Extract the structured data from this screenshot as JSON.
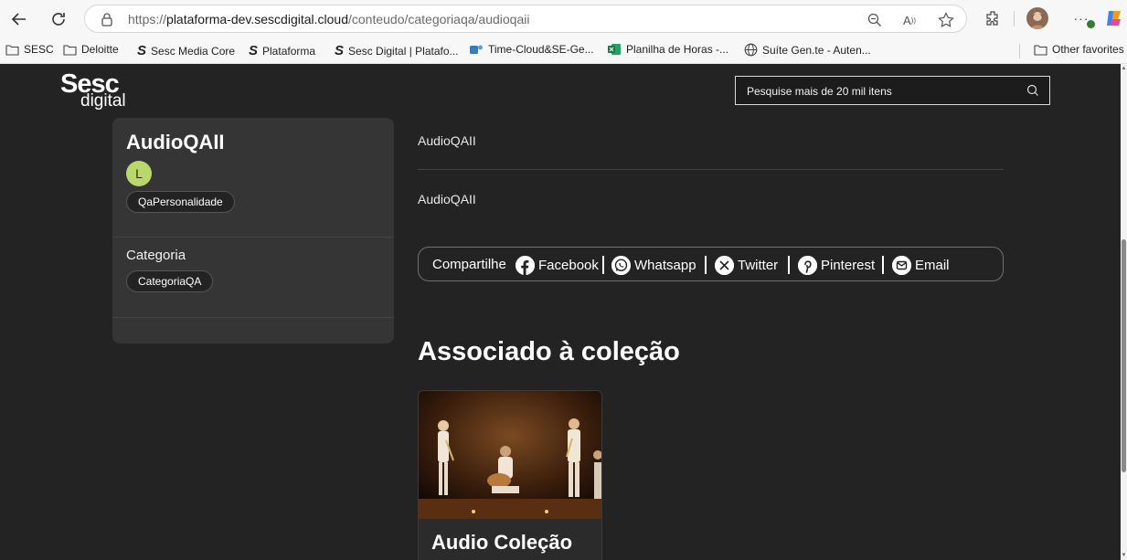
{
  "browser": {
    "url_prefix": "https://",
    "url_host": "plataforma-dev.sescdigital.cloud",
    "url_path": "/conteudo/categoriaqa/audioqaii",
    "bookmarks": [
      "SESC",
      "Deloitte",
      "Sesc Media Core",
      "Plataforma",
      "Sesc Digital | Platafo...",
      "Time-Cloud&SE-Ge...",
      "Planilha de Horas -...",
      "Suíte Gen.te - Auten...",
      "Other favorites"
    ]
  },
  "site": {
    "logo_line1": "Sesc",
    "logo_line2": "digital",
    "search_placeholder": "Pesquise mais de 20 mil itens"
  },
  "card": {
    "title": "AudioQAII",
    "avatar_letter": "L",
    "personality_chip": "QaPersonalidade",
    "category_label": "Categoria",
    "category_chip": "CategoriaQA"
  },
  "main": {
    "info_line1": "AudioQAII",
    "info_line2": "AudioQAII",
    "share": {
      "label": "Compartilhe",
      "facebook": "Facebook",
      "whatsapp": "Whatsapp",
      "twitter": "Twitter",
      "pinterest": "Pinterest",
      "email": "Email"
    },
    "collection_heading": "Associado à coleção",
    "collection_item_title": "Audio Coleção"
  }
}
